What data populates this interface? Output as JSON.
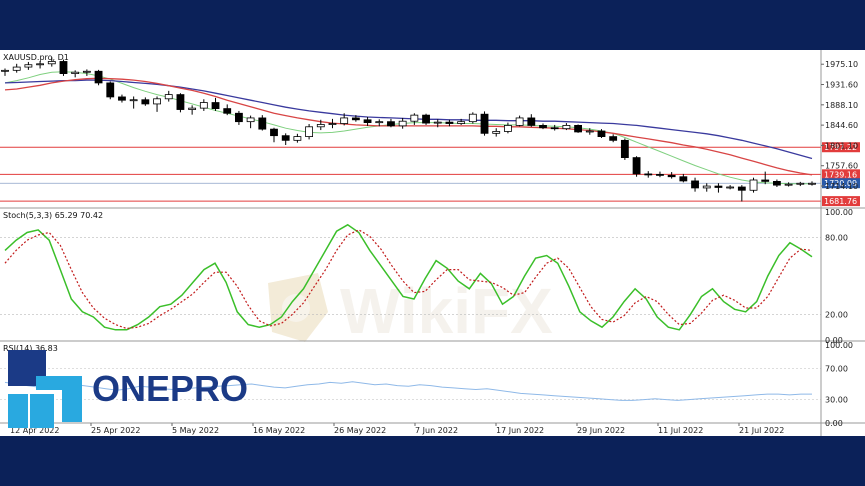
{
  "colors": {
    "background": "#0b2159",
    "chart_bg": "#ffffff",
    "sma_slow": "#3a3a9e",
    "sma_mid": "#d84545",
    "sma_fast": "#7fd07f",
    "stoch_k": "#3bbf2a",
    "stoch_d": "#c21b1b",
    "rsi_line": "#8fb9e8",
    "level_line": "#e23c3c",
    "current_price_bg": "#2a5aa8",
    "logo_blue": "#1b3a86",
    "logo_cyan": "#29a9e0"
  },
  "logo": {
    "text": "ONEPRO"
  },
  "watermark": {
    "text": "WikiFX",
    "icon_name": "wikifx-shield-icon"
  },
  "chart_data": [
    {
      "type": "candlestick",
      "title": "XAUUSD.pro, D1",
      "ylim": [
        1667,
        1997
      ],
      "y_ticks": [
        "1975.10",
        "1931.60",
        "1888.10",
        "1844.60",
        "1801.10",
        "1757.60",
        "1714.10"
      ],
      "x_ticks": [
        "12 Apr 2022",
        "25 Apr 2022",
        "5 May 2022",
        "16 May 2022",
        "26 May 2022",
        "7 Jun 2022",
        "17 Jun 2022",
        "29 Jun 2022",
        "11 Jul 2022",
        "21 Jul 2022"
      ],
      "price_levels": [
        {
          "label": "1797.22",
          "value": 1797.22
        },
        {
          "label": "1739.16",
          "value": 1739.16
        },
        {
          "label": "1681.76",
          "value": 1681.76
        }
      ],
      "current_price": {
        "label": "1720.09",
        "value": 1720.09
      },
      "candles": [
        [
          1960,
          1966,
          1950,
          1962
        ],
        [
          1962,
          1976,
          1957,
          1969
        ],
        [
          1969,
          1980,
          1963,
          1974
        ],
        [
          1974,
          1982,
          1966,
          1976
        ],
        [
          1976,
          1990,
          1970,
          1981
        ],
        [
          1981,
          1985,
          1950,
          1955
        ],
        [
          1955,
          1962,
          1947,
          1958
        ],
        [
          1958,
          1964,
          1950,
          1960
        ],
        [
          1960,
          1963,
          1930,
          1935
        ],
        [
          1935,
          1938,
          1900,
          1905
        ],
        [
          1905,
          1910,
          1893,
          1898
        ],
        [
          1898,
          1906,
          1880,
          1899
        ],
        [
          1899,
          1904,
          1886,
          1890
        ],
        [
          1890,
          1906,
          1873,
          1901
        ],
        [
          1901,
          1918,
          1895,
          1910
        ],
        [
          1910,
          1913,
          1872,
          1878
        ],
        [
          1878,
          1887,
          1867,
          1881
        ],
        [
          1881,
          1900,
          1875,
          1893
        ],
        [
          1893,
          1903,
          1875,
          1880
        ],
        [
          1880,
          1889,
          1866,
          1870
        ],
        [
          1870,
          1875,
          1845,
          1852
        ],
        [
          1852,
          1865,
          1838,
          1860
        ],
        [
          1860,
          1866,
          1833,
          1836
        ],
        [
          1836,
          1839,
          1808,
          1822
        ],
        [
          1822,
          1827,
          1802,
          1812
        ],
        [
          1812,
          1826,
          1807,
          1820
        ],
        [
          1820,
          1847,
          1814,
          1841
        ],
        [
          1841,
          1856,
          1834,
          1846
        ],
        [
          1846,
          1858,
          1838,
          1848
        ],
        [
          1848,
          1870,
          1844,
          1860
        ],
        [
          1860,
          1866,
          1852,
          1856
        ],
        [
          1856,
          1862,
          1843,
          1850
        ],
        [
          1850,
          1857,
          1842,
          1852
        ],
        [
          1852,
          1858,
          1840,
          1843
        ],
        [
          1843,
          1860,
          1837,
          1853
        ],
        [
          1853,
          1870,
          1845,
          1866
        ],
        [
          1866,
          1869,
          1845,
          1849
        ],
        [
          1849,
          1857,
          1840,
          1851
        ],
        [
          1851,
          1856,
          1842,
          1848
        ],
        [
          1848,
          1858,
          1845,
          1852
        ],
        [
          1852,
          1872,
          1848,
          1868
        ],
        [
          1868,
          1874,
          1822,
          1827
        ],
        [
          1827,
          1838,
          1820,
          1831
        ],
        [
          1831,
          1850,
          1827,
          1844
        ],
        [
          1844,
          1865,
          1842,
          1860
        ],
        [
          1860,
          1868,
          1841,
          1844
        ],
        [
          1844,
          1848,
          1836,
          1839
        ],
        [
          1839,
          1845,
          1833,
          1837
        ],
        [
          1837,
          1849,
          1834,
          1844
        ],
        [
          1844,
          1846,
          1828,
          1830
        ],
        [
          1830,
          1838,
          1824,
          1832
        ],
        [
          1832,
          1836,
          1817,
          1820
        ],
        [
          1820,
          1825,
          1808,
          1812
        ],
        [
          1812,
          1816,
          1770,
          1775
        ],
        [
          1775,
          1778,
          1734,
          1740
        ],
        [
          1740,
          1746,
          1732,
          1739
        ],
        [
          1739,
          1745,
          1733,
          1737
        ],
        [
          1737,
          1744,
          1730,
          1734
        ],
        [
          1734,
          1740,
          1722,
          1725
        ],
        [
          1725,
          1732,
          1702,
          1710
        ],
        [
          1710,
          1720,
          1702,
          1714
        ],
        [
          1714,
          1720,
          1700,
          1711
        ],
        [
          1711,
          1716,
          1707,
          1712
        ],
        [
          1712,
          1716,
          1681,
          1705
        ],
        [
          1705,
          1732,
          1700,
          1727
        ],
        [
          1727,
          1745,
          1718,
          1724
        ],
        [
          1724,
          1728,
          1712,
          1716
        ],
        [
          1716,
          1722,
          1713,
          1718
        ],
        [
          1718,
          1723,
          1714,
          1720
        ],
        [
          1720,
          1724,
          1715,
          1720
        ]
      ],
      "sma_slow": [
        1935,
        1936,
        1937,
        1938,
        1939,
        1940,
        1940,
        1941,
        1941,
        1940,
        1938,
        1936,
        1934,
        1932,
        1929,
        1926,
        1922,
        1918,
        1913,
        1908,
        1903,
        1898,
        1893,
        1888,
        1883,
        1879,
        1875,
        1872,
        1869,
        1866,
        1864,
        1862,
        1861,
        1860,
        1859,
        1858,
        1857,
        1857,
        1856,
        1856,
        1855,
        1855,
        1855,
        1854,
        1854,
        1854,
        1853,
        1853,
        1852,
        1851,
        1850,
        1849,
        1848,
        1846,
        1844,
        1841,
        1838,
        1835,
        1832,
        1829,
        1826,
        1822,
        1817,
        1812,
        1806,
        1800,
        1794,
        1787,
        1780,
        1773
      ],
      "sma_mid": [
        1920,
        1922,
        1926,
        1930,
        1935,
        1939,
        1942,
        1944,
        1945,
        1944,
        1943,
        1941,
        1938,
        1934,
        1929,
        1924,
        1919,
        1913,
        1906,
        1898,
        1891,
        1884,
        1877,
        1870,
        1865,
        1860,
        1856,
        1852,
        1849,
        1847,
        1845,
        1844,
        1843,
        1843,
        1843,
        1843,
        1843,
        1843,
        1843,
        1843,
        1843,
        1842,
        1842,
        1841,
        1841,
        1840,
        1839,
        1838,
        1837,
        1835,
        1833,
        1830,
        1827,
        1823,
        1819,
        1815,
        1811,
        1807,
        1802,
        1798,
        1793,
        1787,
        1781,
        1774,
        1767,
        1760,
        1753,
        1747,
        1742,
        1738
      ],
      "sma_fast": [
        1935,
        1940,
        1946,
        1953,
        1958,
        1959,
        1958,
        1955,
        1950,
        1943,
        1934,
        1925,
        1917,
        1910,
        1904,
        1897,
        1890,
        1883,
        1876,
        1870,
        1864,
        1858,
        1852,
        1845,
        1838,
        1833,
        1829,
        1828,
        1829,
        1832,
        1836,
        1840,
        1843,
        1846,
        1848,
        1850,
        1850,
        1850,
        1849,
        1848,
        1848,
        1847,
        1846,
        1845,
        1845,
        1844,
        1843,
        1842,
        1841,
        1839,
        1836,
        1832,
        1827,
        1818,
        1808,
        1798,
        1788,
        1778,
        1768,
        1758,
        1749,
        1740,
        1733,
        1727,
        1723,
        1721,
        1720,
        1719,
        1719,
        1719
      ]
    },
    {
      "type": "line",
      "title": "Stoch(5,3,3) 65.29 70.42",
      "ylim": [
        0,
        100
      ],
      "y_ticks": [
        "100.00",
        "80.00",
        "20.00",
        "0.00"
      ],
      "series": [
        {
          "key": "k",
          "values": [
            70,
            78,
            84,
            86,
            78,
            55,
            32,
            22,
            18,
            10,
            8,
            8,
            12,
            18,
            26,
            28,
            35,
            45,
            55,
            60,
            45,
            22,
            12,
            10,
            12,
            18,
            30,
            40,
            55,
            70,
            85,
            90,
            84,
            70,
            58,
            46,
            34,
            32,
            48,
            62,
            56,
            46,
            40,
            52,
            44,
            28,
            34,
            50,
            64,
            66,
            60,
            42,
            22,
            15,
            10,
            18,
            30,
            40,
            32,
            18,
            10,
            8,
            20,
            34,
            40,
            30,
            24,
            22,
            30,
            50,
            66,
            76,
            71,
            65
          ]
        },
        {
          "key": "d",
          "values": [
            60,
            70,
            78,
            82,
            84,
            74,
            55,
            37,
            25,
            17,
            12,
            9,
            10,
            13,
            19,
            24,
            30,
            36,
            45,
            53,
            53,
            42,
            27,
            15,
            11,
            13,
            20,
            29,
            42,
            55,
            70,
            82,
            86,
            81,
            71,
            58,
            46,
            37,
            38,
            47,
            55,
            55,
            47,
            46,
            45,
            41,
            35,
            37,
            49,
            60,
            64,
            56,
            41,
            26,
            16,
            14,
            19,
            29,
            34,
            30,
            20,
            12,
            13,
            21,
            31,
            35,
            31,
            25,
            25,
            34,
            49,
            64,
            71,
            70
          ]
        }
      ]
    },
    {
      "type": "line",
      "title": "RSI(14) 36.83",
      "ylim": [
        0,
        100
      ],
      "y_ticks": [
        "100.00",
        "70.00",
        "30.00",
        "0.00"
      ],
      "series": [
        {
          "key": "rsi",
          "values": [
            52,
            50,
            48,
            46,
            45,
            47,
            49,
            48,
            46,
            44,
            42,
            44,
            47,
            46,
            44,
            43,
            44,
            45,
            46,
            47,
            48,
            49,
            50,
            48,
            46,
            45,
            47,
            49,
            50,
            52,
            51,
            53,
            51,
            49,
            50,
            48,
            47,
            49,
            48,
            46,
            45,
            44,
            43,
            44,
            42,
            40,
            38,
            37,
            36,
            35,
            34,
            33,
            32,
            31,
            30,
            29,
            29,
            30,
            31,
            30,
            29,
            30,
            31,
            32,
            33,
            34,
            35,
            36,
            37,
            37,
            36,
            37,
            37
          ]
        }
      ]
    }
  ]
}
